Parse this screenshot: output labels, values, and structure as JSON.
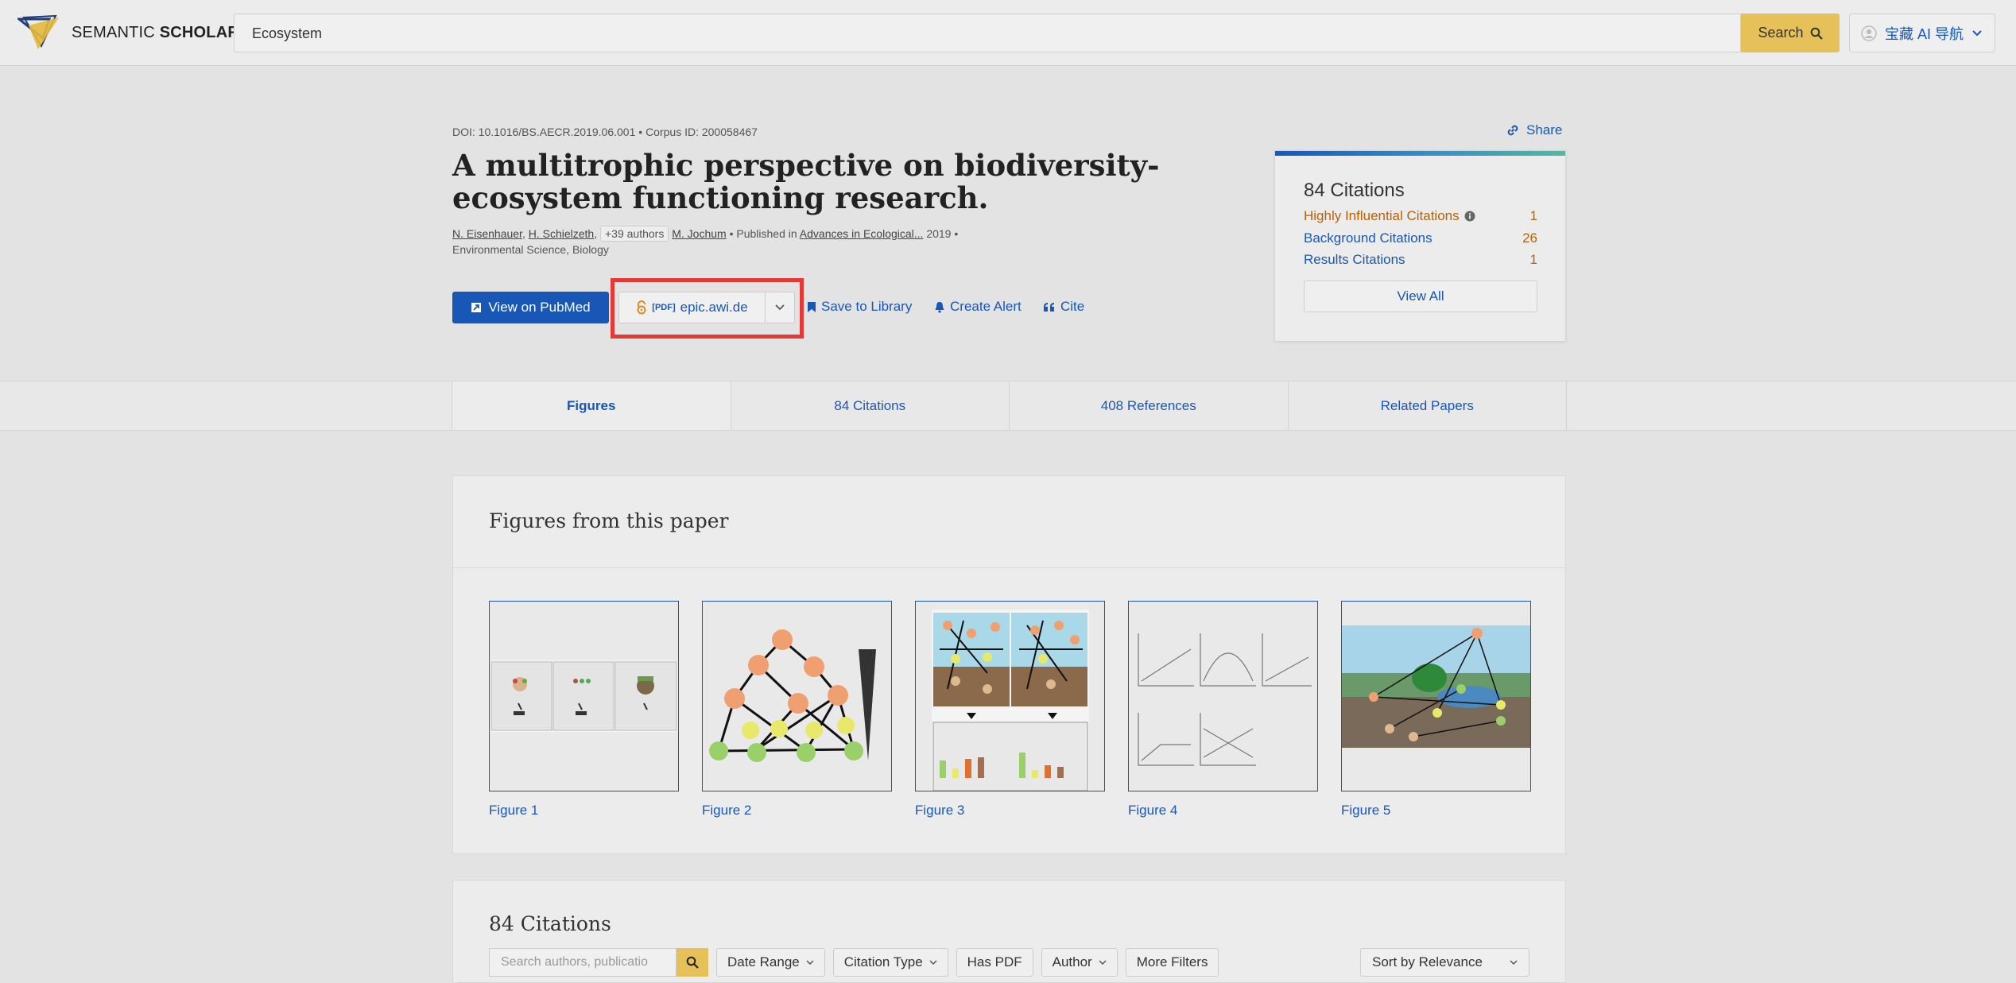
{
  "header": {
    "logo_text_1": "SEMANTIC",
    "logo_text_2": "SCHOLAR",
    "search_value": "Ecosystem",
    "search_button": "Search",
    "user_label": "宝藏 AI 导航"
  },
  "paper": {
    "doi": "DOI: 10.1016/BS.AECR.2019.06.001",
    "corpus": "Corpus ID: 200058467",
    "title": "A multitrophic perspective on biodiversity-ecosystem functioning research.",
    "authors": [
      "N. Eisenhauer",
      "H. Schielzeth",
      "M. Jochum"
    ],
    "more_authors": "+39 authors",
    "published_prefix": "Published in",
    "venue": "Advances in Ecological...",
    "year": "2019",
    "fields": "Environmental Science, Biology"
  },
  "actions": {
    "pubmed": "View on PubMed",
    "pdf_tag": "[PDF]",
    "pdf_source": "epic.awi.de",
    "save": "Save to Library",
    "alert": "Create Alert",
    "cite": "Cite",
    "share": "Share"
  },
  "citations_card": {
    "title": "84 Citations",
    "rows": [
      {
        "label": "Highly Influential Citations",
        "value": "1"
      },
      {
        "label": "Background Citations",
        "value": "26"
      },
      {
        "label": "Results Citations",
        "value": "1"
      }
    ],
    "view_all": "View All"
  },
  "tabs": [
    {
      "label": "Figures",
      "active": true
    },
    {
      "label": "84 Citations",
      "active": false
    },
    {
      "label": "408 References",
      "active": false
    },
    {
      "label": "Related Papers",
      "active": false
    }
  ],
  "figures": {
    "title": "Figures from this paper",
    "items": [
      "Figure 1",
      "Figure 2",
      "Figure 3",
      "Figure 4",
      "Figure 5"
    ]
  },
  "citations_section": {
    "title": "84 Citations",
    "search_placeholder": "Search authors, publicatio",
    "filters": [
      "Date Range",
      "Citation Type",
      "Has PDF",
      "Author",
      "More Filters"
    ],
    "sort": "Sort by Relevance"
  },
  "colors": {
    "accent": "#1857b6",
    "search": "#e6c15a",
    "highlight": "#e53935",
    "count": "#b5620b"
  }
}
